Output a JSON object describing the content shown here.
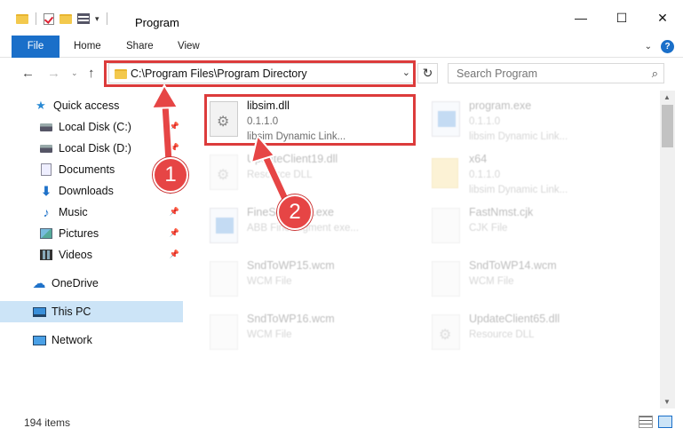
{
  "window": {
    "title": "Program",
    "minimize": "—",
    "maximize": "☐",
    "close": "✕"
  },
  "ribbon": {
    "tabs": [
      "File",
      "Home",
      "Share",
      "View"
    ]
  },
  "nav": {
    "back": "←",
    "forward": "→",
    "recent": "⌄",
    "up": "↑",
    "address": "C:\\Program Files\\Program Directory",
    "refresh": "↻",
    "search_placeholder": "Search Program"
  },
  "sidebar": {
    "items": [
      {
        "label": "Quick access",
        "icon": "star-icon"
      },
      {
        "label": "Local Disk (C:)",
        "icon": "disk-icon"
      },
      {
        "label": "Local Disk (D:)",
        "icon": "disk-icon"
      },
      {
        "label": "Documents",
        "icon": "documents-icon"
      },
      {
        "label": "Downloads",
        "icon": "downloads-icon"
      },
      {
        "label": "Music",
        "icon": "music-icon"
      },
      {
        "label": "Pictures",
        "icon": "pictures-icon"
      },
      {
        "label": "Videos",
        "icon": "videos-icon"
      },
      {
        "label": "OneDrive",
        "icon": "onedrive-icon"
      },
      {
        "label": "This PC",
        "icon": "this-pc-icon"
      },
      {
        "label": "Network",
        "icon": "network-icon"
      }
    ]
  },
  "files": [
    {
      "name": "libsim.dll",
      "version": "0.1.1.0",
      "desc": "libsim Dynamic Link..."
    },
    {
      "name": "program.exe",
      "version": "0.1.1.0",
      "desc": "libsim Dynamic Link..."
    },
    {
      "name": "UpdateClient19.dll",
      "version": "",
      "desc": "Resource DLL"
    },
    {
      "name": "x64",
      "version": "0.1.1.0",
      "desc": "libsim Dynamic Link..."
    },
    {
      "name": "FineSegment.exe",
      "version": "",
      "desc": "ABB FineSegment exe..."
    },
    {
      "name": "FastNmst.cjk",
      "version": "",
      "desc": "CJK File"
    },
    {
      "name": "SndToWP15.wcm",
      "version": "",
      "desc": "WCM File"
    },
    {
      "name": "SndToWP14.wcm",
      "version": "",
      "desc": "WCM File"
    },
    {
      "name": "SndToWP16.wcm",
      "version": "",
      "desc": "WCM File"
    },
    {
      "name": "UpdateClient65.dll",
      "version": "",
      "desc": "Resource DLL"
    }
  ],
  "status": {
    "item_count": "194 items"
  },
  "annotations": {
    "step1": "1",
    "step2": "2",
    "highlight_color": "#dc3b3b"
  }
}
